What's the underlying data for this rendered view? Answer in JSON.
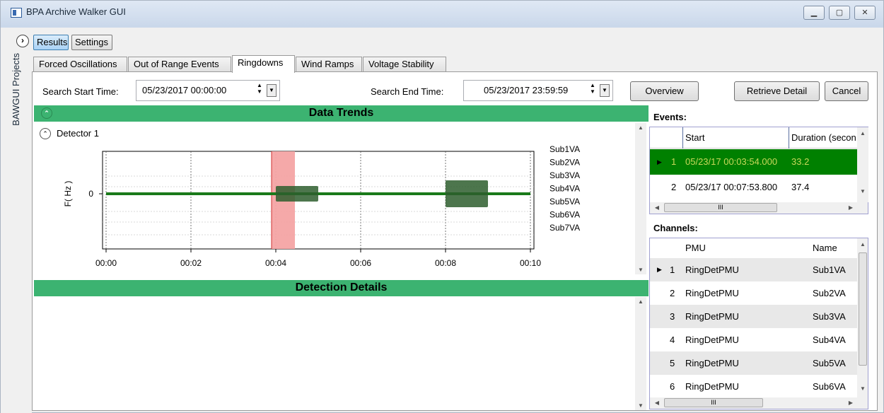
{
  "window": {
    "title": "BPA Archive Walker GUI",
    "minimize": "▁",
    "maximize": "▢",
    "close": "✕"
  },
  "sidebar": {
    "expand": "›",
    "label": "BAWGUI Projects"
  },
  "top_buttons": {
    "results": "Results",
    "settings": "Settings"
  },
  "tabs": [
    "Forced Oscillations",
    "Out of Range Events",
    "Ringdowns",
    "Wind Ramps",
    "Voltage Stability"
  ],
  "selected_tab": "Ringdowns",
  "search": {
    "start_label": "Search Start Time:",
    "start_value": "05/23/2017 00:00:00",
    "end_label": "Search End Time:",
    "end_value": "05/23/2017 23:59:59"
  },
  "buttons": {
    "overview": "Overview",
    "retrieve": "Retrieve Detail",
    "cancel": "Cancel"
  },
  "data_trends": {
    "title": "Data Trends",
    "detector": "Detector 1"
  },
  "detection_details": {
    "title": "Detection Details"
  },
  "chart_data": {
    "type": "line",
    "ylabel": "F( Hz )",
    "xlabel": "",
    "x_ticks": [
      "00:00",
      "00:02",
      "00:04",
      "00:06",
      "00:08",
      "00:10"
    ],
    "y_ticks": [
      "0"
    ],
    "xlim": [
      0,
      10
    ],
    "legend": [
      "Sub1VA",
      "Sub2VA",
      "Sub3VA",
      "Sub4VA",
      "Sub5VA",
      "Sub6VA",
      "Sub7VA"
    ],
    "highlight_range": [
      3.9,
      4.45
    ],
    "oscillation_bursts": [
      [
        4.0,
        5.0
      ],
      [
        8.0,
        9.0
      ]
    ],
    "grid": true,
    "colors": {
      "trace": "#1a7a1a",
      "highlight": "#f4a4a4",
      "burst": "#2e5e2e"
    }
  },
  "events": {
    "heading": "Events:",
    "columns": [
      "Start",
      "Duration (secon"
    ],
    "rows": [
      {
        "num": "1",
        "start": "05/23/17 00:03:54.000",
        "duration": "33.2"
      },
      {
        "num": "2",
        "start": "05/23/17 00:07:53.800",
        "duration": "37.4"
      }
    ],
    "hscroll": "III"
  },
  "channels": {
    "heading": "Channels:",
    "columns": [
      "PMU",
      "Name"
    ],
    "rows": [
      {
        "num": "1",
        "pmu": "RingDetPMU",
        "name": "Sub1VA"
      },
      {
        "num": "2",
        "pmu": "RingDetPMU",
        "name": "Sub2VA"
      },
      {
        "num": "3",
        "pmu": "RingDetPMU",
        "name": "Sub3VA"
      },
      {
        "num": "4",
        "pmu": "RingDetPMU",
        "name": "Sub4VA"
      },
      {
        "num": "5",
        "pmu": "RingDetPMU",
        "name": "Sub5VA"
      },
      {
        "num": "6",
        "pmu": "RingDetPMU",
        "name": "Sub6VA"
      }
    ],
    "hscroll": "III"
  }
}
